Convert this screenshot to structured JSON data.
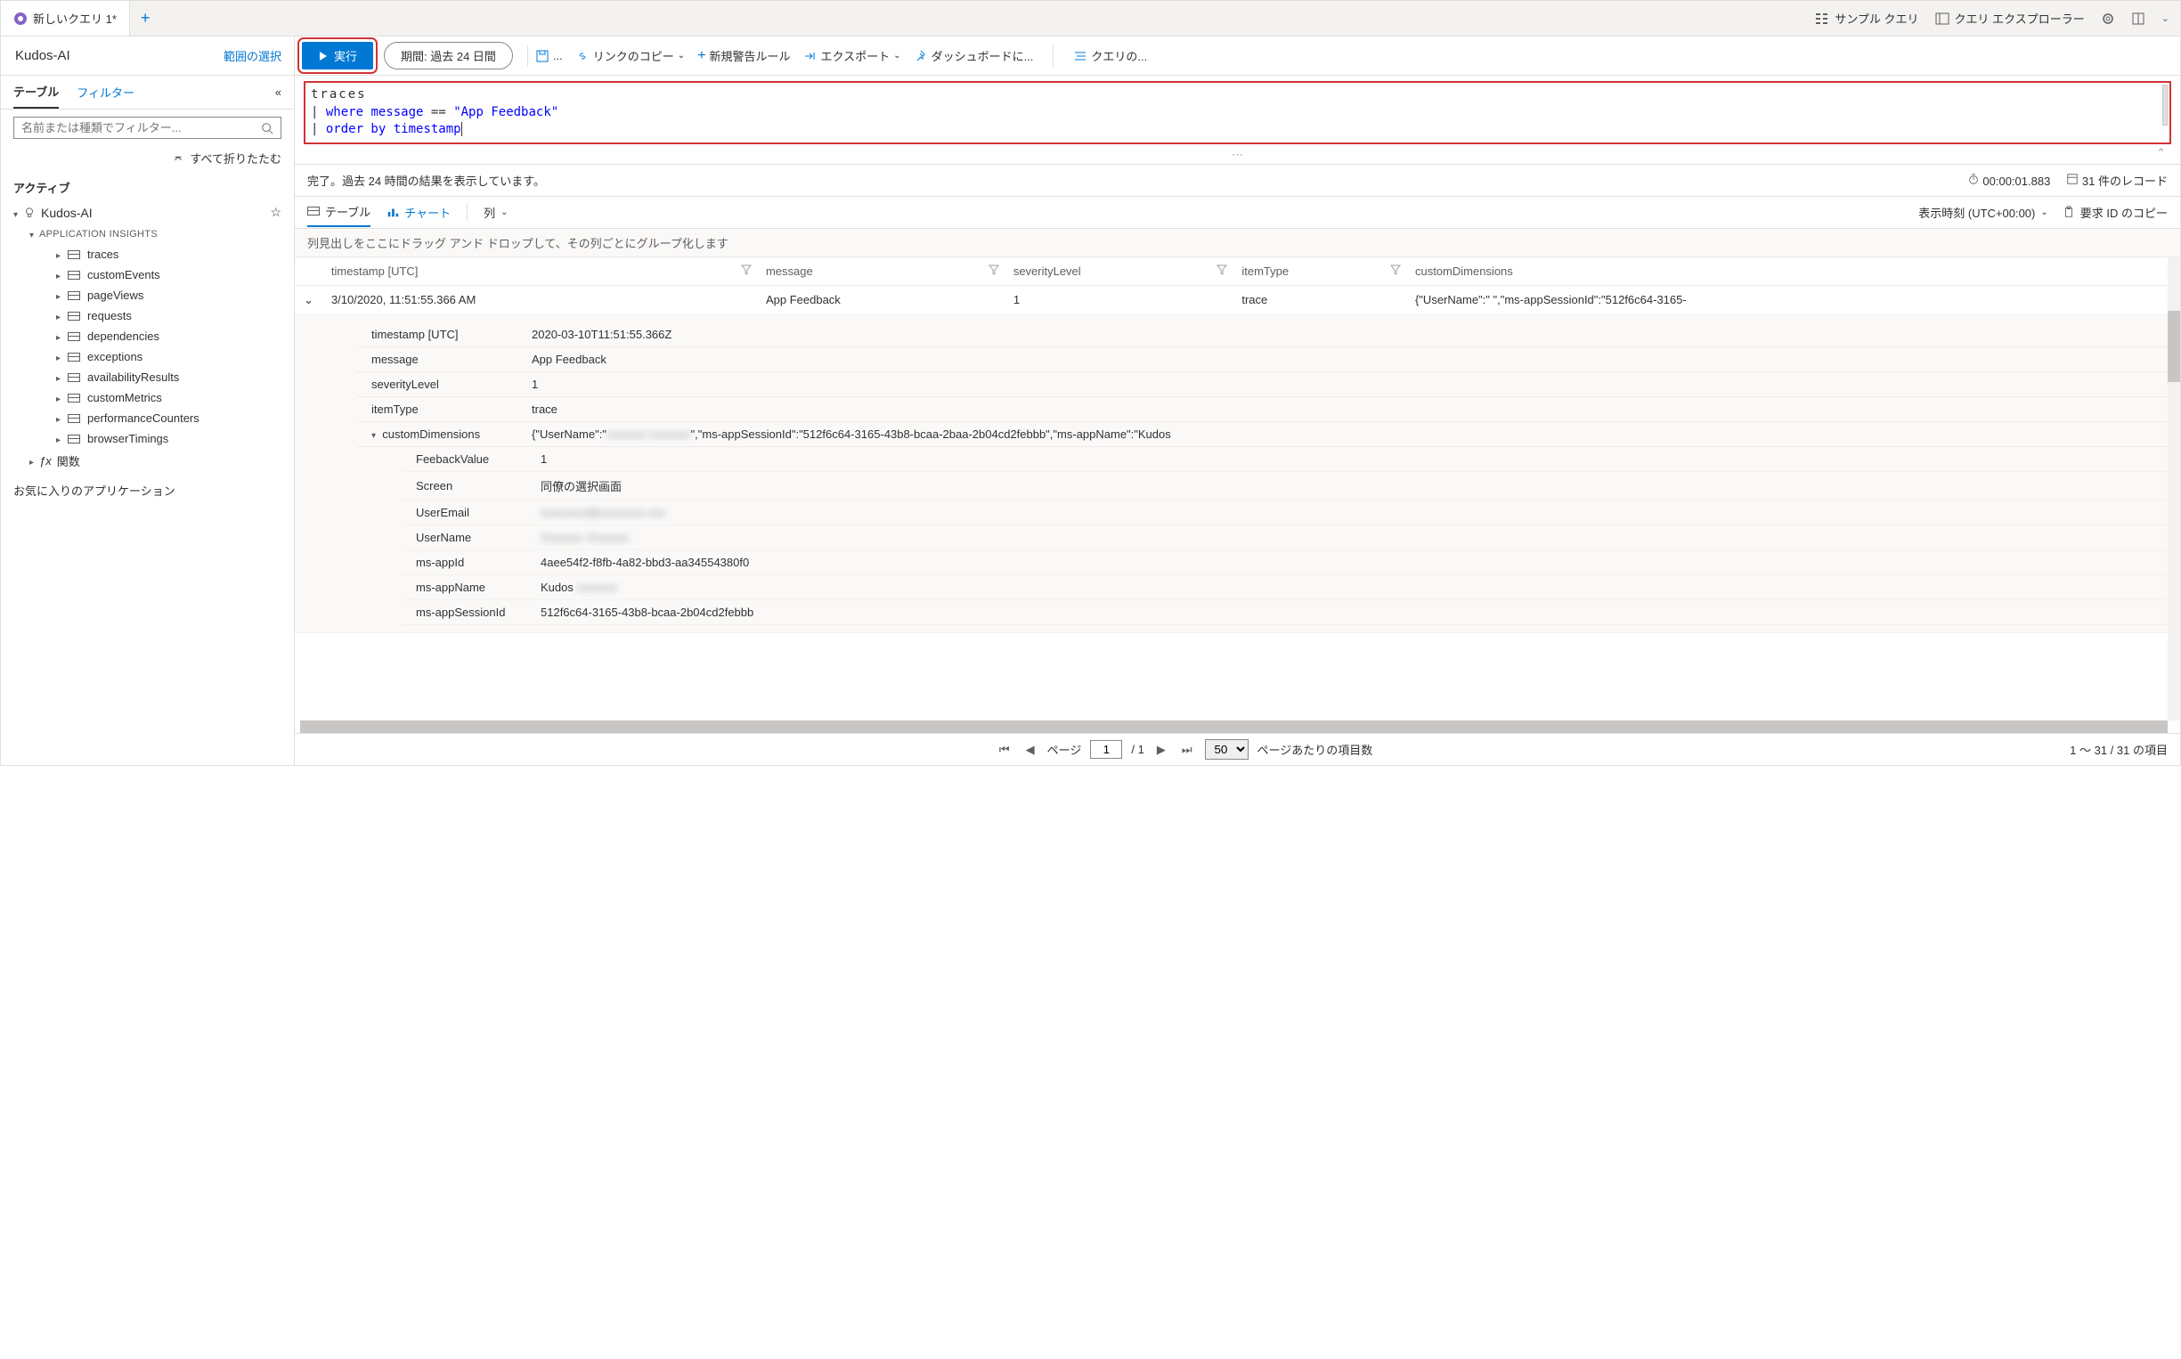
{
  "tabs": {
    "active": "新しいクエリ 1*"
  },
  "topRight": {
    "sample": "サンプル クエリ",
    "explorer": "クエリ エクスプローラー"
  },
  "header": {
    "appName": "Kudos-AI",
    "scope": "範囲の選択",
    "run": "実行",
    "timeRange": "期間: 過去 24 日間"
  },
  "toolbar": {
    "copyLink": "リンクのコピー",
    "newAlert": "新規警告ルール",
    "export": "エクスポート",
    "pinDashboard": "ダッシュボードに...",
    "querySettings": "クエリの..."
  },
  "sidebar": {
    "tabTable": "テーブル",
    "tabFilter": "フィルター",
    "searchPlaceholder": "名前または種類でフィルター...",
    "collapseAll": "すべて折りたたむ",
    "active": "アクティブ",
    "root": "Kudos-AI",
    "group": "APPLICATION INSIGHTS",
    "leaves": [
      "traces",
      "customEvents",
      "pageViews",
      "requests",
      "dependencies",
      "exceptions",
      "availabilityResults",
      "customMetrics",
      "performanceCounters",
      "browserTimings"
    ],
    "functions": "関数",
    "favorites": "お気に入りのアプリケーション"
  },
  "query": {
    "l1": "traces",
    "l2a": "where",
    "l2b": "message",
    "l2c": "==",
    "l2d": "\"App Feedback\"",
    "l3a": "order by",
    "l3b": "timestamp"
  },
  "status": {
    "done": "完了。過去 24 時間の結果を表示しています。",
    "duration": "00:00:01.883",
    "records": "31 件のレコード"
  },
  "resultTabs": {
    "table": "テーブル",
    "chart": "チャート",
    "columns": "列",
    "displayTime": "表示時刻 (UTC+00:00)",
    "copyReqId": "要求 ID のコピー"
  },
  "groupHint": "列見出しをここにドラッグ アンド ドロップして、その列ごとにグループ化します",
  "columns": {
    "timestamp": "timestamp [UTC]",
    "message": "message",
    "severity": "severityLevel",
    "itemType": "itemType",
    "custom": "customDimensions"
  },
  "row": {
    "timestamp": "3/10/2020, 11:51:55.366 AM",
    "message": "App Feedback",
    "severity": "1",
    "itemType": "trace",
    "custom": "{\"UserName\":\"            \",\"ms-appSessionId\":\"512f6c64-3165-"
  },
  "detail": {
    "labels": {
      "ts": "timestamp [UTC]",
      "msg": "message",
      "sev": "severityLevel",
      "it": "itemType",
      "cd": "customDimensions"
    },
    "ts": "2020-03-10T11:51:55.366Z",
    "msg": "App Feedback",
    "sev": "1",
    "it": "trace",
    "cdPrefix": "{\"UserName\":\"",
    "cdSuffix": "\",\"ms-appSessionId\":\"512f6c64-3165-43b8-bcaa-2baa-2b04cd2febbb\",\"ms-appName\":\"Kudos"
  },
  "nested": {
    "labels": {
      "fv": "FeebackValue",
      "sc": "Screen",
      "ue": "UserEmail",
      "un": "UserName",
      "ai": "ms-appId",
      "an": "ms-appName",
      "as": "ms-appSessionId"
    },
    "fv": "1",
    "sc": "同僚の選択画面",
    "ue": "redacted",
    "un": "redacted",
    "ai": "4aee54f2-f8fb-4a82-bbd3-aa34554380f0",
    "anPrefix": "Kudos",
    "as": "512f6c64-3165-43b8-bcaa-2b04cd2febbb"
  },
  "pager": {
    "page": "ページ",
    "pageVal": "1",
    "totalPages": "/ 1",
    "pageSize": "50",
    "perPage": "ページあたりの項目数",
    "range": "1 〜 31 / 31 の項目"
  }
}
